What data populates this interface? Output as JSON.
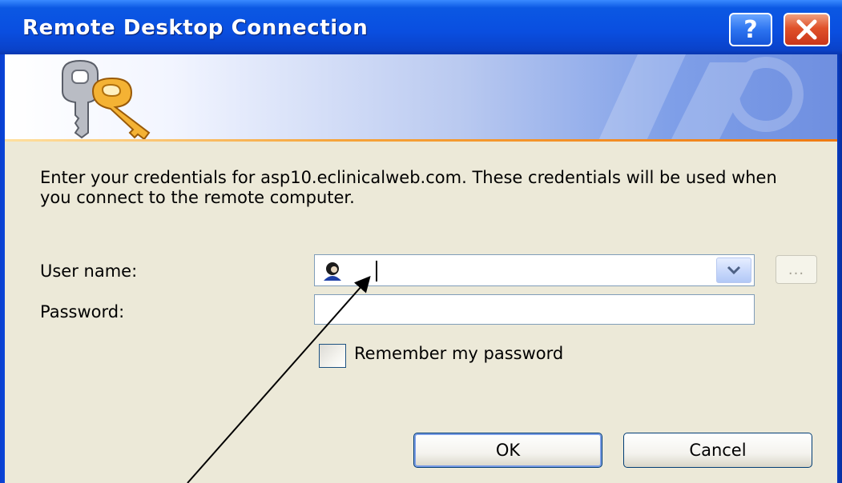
{
  "window": {
    "title": "Remote Desktop Connection",
    "help_label": "?",
    "close_label": "✕"
  },
  "dialog": {
    "prompt": "Enter your credentials for asp10.eclinicalweb.com. These credentials will be used when you connect to the remote computer.",
    "username_label": "User name:",
    "username_value": "",
    "password_label": "Password:",
    "password_value": "",
    "browse_label": "...",
    "remember_label": "Remember my password",
    "remember_checked": false,
    "ok_label": "OK",
    "cancel_label": "Cancel"
  },
  "icons": {
    "banner": "keys-icon",
    "username": "user-icon",
    "dropdown": "chevron-down-icon"
  },
  "colors": {
    "titlebar": "#0a4ee0",
    "client_background": "#ece9d8",
    "banner_rule": "#ef7a12",
    "close_button": "#e0522a"
  }
}
